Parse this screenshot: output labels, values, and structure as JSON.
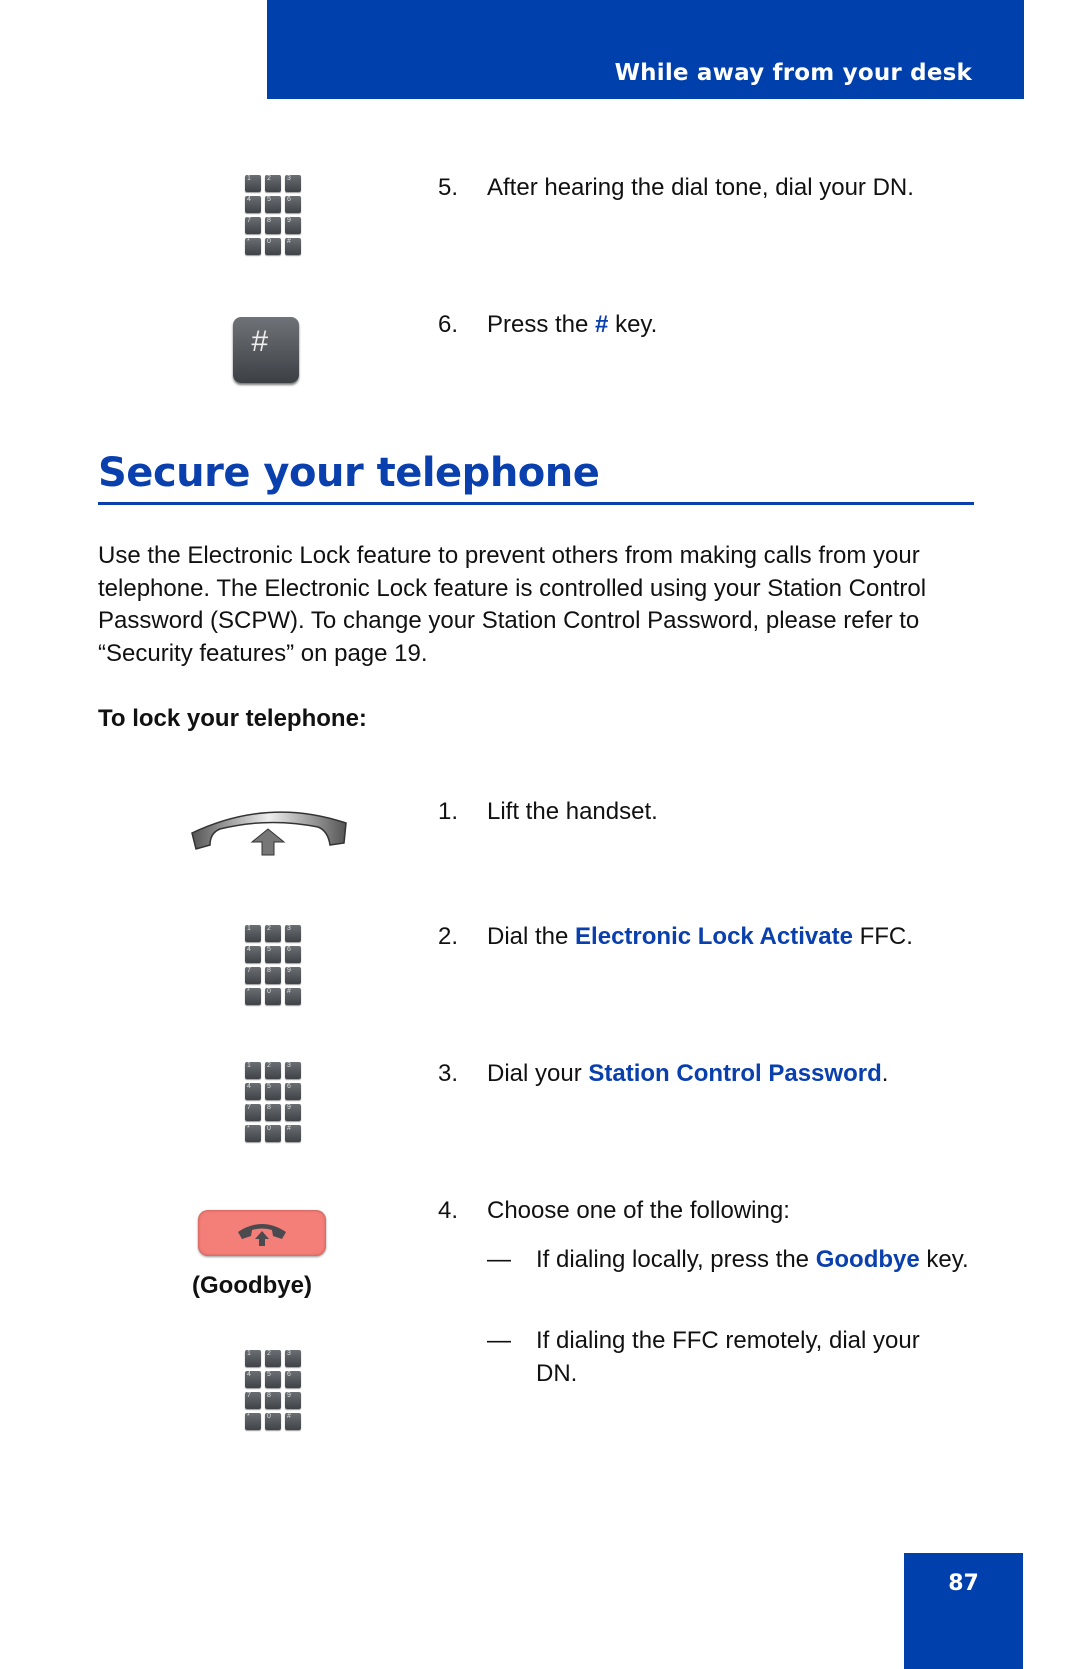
{
  "header": {
    "section_title": "While away from your desk"
  },
  "top_steps": [
    {
      "num": "5.",
      "text": "After hearing the dial tone, dial your DN."
    },
    {
      "num": "6.",
      "pre": "Press the ",
      "highlight": "#",
      "post": " key."
    }
  ],
  "section": {
    "heading": "Secure your telephone",
    "paragraph": "Use the Electronic Lock feature to prevent others from making calls from your telephone. The Electronic Lock feature is controlled using your Station Control Password (SCPW). To change your Station Control Password, please refer to “Security features” on page 19.",
    "subheading": "To lock your telephone:"
  },
  "lock_steps": [
    {
      "num": "1.",
      "text": "Lift the handset."
    },
    {
      "num": "2.",
      "pre": "Dial the ",
      "highlight": "Electronic Lock Activate",
      "post": " FFC."
    },
    {
      "num": "3.",
      "pre": "Dial your ",
      "highlight": "Station Control Password",
      "post": "."
    },
    {
      "num": "4.",
      "text": "Choose one of the following:"
    }
  ],
  "options": [
    {
      "dash": "—",
      "pre": "If dialing locally, press the ",
      "highlight": "Goodbye",
      "post": " key."
    },
    {
      "dash": "—",
      "text": "If dialing the FFC remotely, dial your DN."
    }
  ],
  "icons": {
    "keypad_keys": [
      "1",
      "2",
      "3",
      "4",
      "5",
      "6",
      "7",
      "8",
      "9",
      "*",
      "0",
      "#"
    ],
    "hash_key": "#",
    "goodbye_label": "(Goodbye)"
  },
  "colors": {
    "brand_blue": "#0040ad",
    "highlight_blue": "#0a3fae",
    "goodbye_key": "#f47f78"
  },
  "footer": {
    "page_number": "87"
  }
}
